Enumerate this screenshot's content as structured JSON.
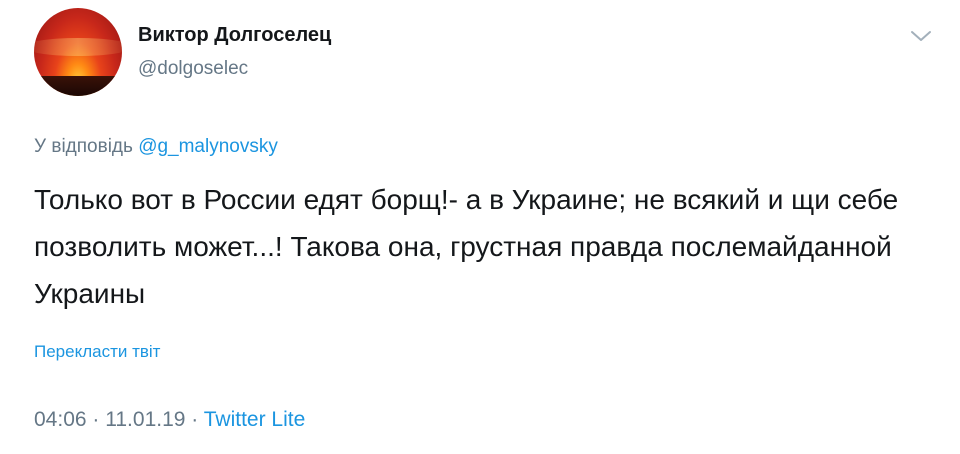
{
  "author": {
    "display_name": "Виктор Долгоселец",
    "handle": "@dolgoselec"
  },
  "tweet": {
    "reply_prefix": "У відповідь",
    "reply_to": "@g_malynovsky",
    "text": "Только вот в России едят борщ!- а в Украине; не всякий и щи себе позволить может...! Такова она, грустная правда послемайданной Украины",
    "translate_label": "Перекласти твіт",
    "time": "04:06",
    "date": "11.01.19",
    "separator": "·",
    "source": "Twitter Lite"
  },
  "icons": {
    "menu": "chevron-down-icon"
  },
  "colors": {
    "text": "#14171a",
    "secondary": "#657786",
    "link": "#1b95e0"
  }
}
